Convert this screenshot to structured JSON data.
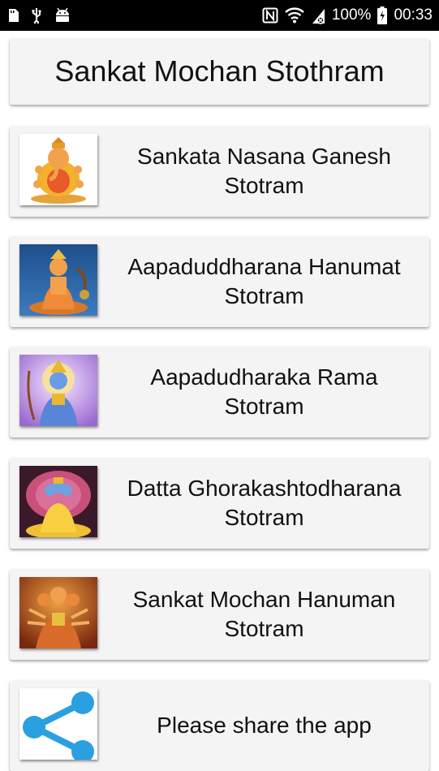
{
  "status_bar": {
    "battery_text": "100%",
    "time": "00:33",
    "icons": [
      "sd-card-icon",
      "usb-icon",
      "android-icon",
      "nfc-icon",
      "wifi-icon",
      "battery-charging-icon"
    ]
  },
  "header": {
    "title": "Sankat Mochan Stothram"
  },
  "items": [
    {
      "label": "Sankata Nasana Ganesh Stotram",
      "thumb": "ganesh-image"
    },
    {
      "label": "Aapaduddharana Hanumat Stotram",
      "thumb": "hanuman-image"
    },
    {
      "label": "Aapadudharaka Rama Stotram",
      "thumb": "rama-image"
    },
    {
      "label": "Datta Ghorakashtodharana Stotram",
      "thumb": "datta-image"
    },
    {
      "label": "Sankat Mochan Hanuman Stotram",
      "thumb": "panchmukhi-hanuman-image"
    },
    {
      "label": "Please share the app",
      "thumb": "share-icon"
    }
  ]
}
